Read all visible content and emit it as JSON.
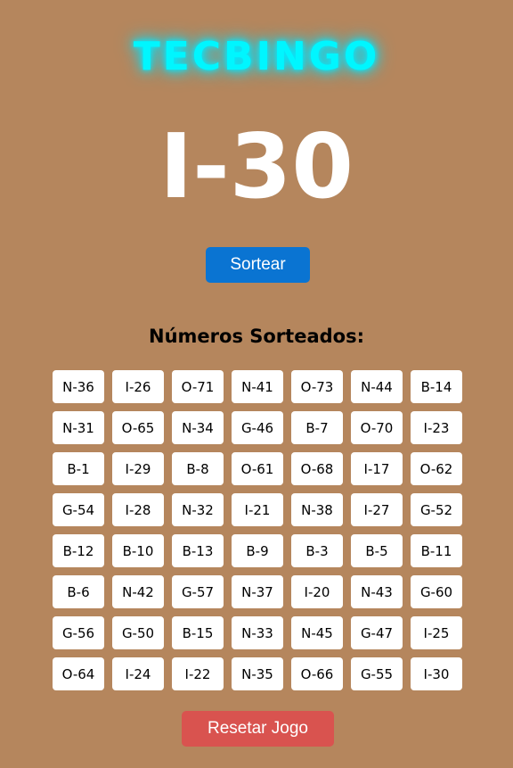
{
  "app": {
    "title": "TECBINGO"
  },
  "current_number": "I-30",
  "buttons": {
    "draw_label": "Sortear",
    "reset_label": "Resetar Jogo"
  },
  "drawn_section": {
    "heading": "Números Sorteados:",
    "numbers": [
      "N-36",
      "I-26",
      "O-71",
      "N-41",
      "O-73",
      "N-44",
      "B-14",
      "N-31",
      "O-65",
      "N-34",
      "G-46",
      "B-7",
      "O-70",
      "I-23",
      "B-1",
      "I-29",
      "B-8",
      "O-61",
      "O-68",
      "I-17",
      "O-62",
      "G-54",
      "I-28",
      "N-32",
      "I-21",
      "N-38",
      "I-27",
      "G-52",
      "B-12",
      "B-10",
      "B-13",
      "B-9",
      "B-3",
      "B-5",
      "B-11",
      "B-6",
      "N-42",
      "G-57",
      "N-37",
      "I-20",
      "N-43",
      "G-60",
      "G-56",
      "G-50",
      "B-15",
      "N-33",
      "N-45",
      "G-47",
      "I-25",
      "O-64",
      "I-24",
      "I-22",
      "N-35",
      "O-66",
      "G-55",
      "I-30"
    ]
  },
  "colors": {
    "background": "#b5865d",
    "title_glow": "#00f6ff",
    "draw_button": "#0a74d2",
    "reset_button": "#d9534f",
    "cell_background": "#ffffff"
  }
}
